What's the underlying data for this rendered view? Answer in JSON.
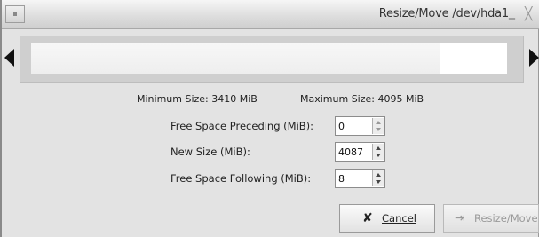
{
  "window": {
    "title": "Resize/Move /dev/hda1",
    "minimize_glyph": "_",
    "close_glyph": "╳"
  },
  "sizes": {
    "minimum": "Minimum Size: 3410 MiB",
    "maximum": "Maximum Size: 4095 MiB"
  },
  "form": {
    "free_preceding_label": "Free Space Preceding (MiB):",
    "free_preceding_value": "0",
    "new_size_label": "New Size (MiB):",
    "new_size_value": "4087",
    "free_following_label": "Free Space Following (MiB):",
    "free_following_value": "8"
  },
  "buttons": {
    "cancel_label": "Cancel",
    "cancel_icon": "✘",
    "resize_label": "Resize/Move",
    "resize_icon": "⇥"
  }
}
